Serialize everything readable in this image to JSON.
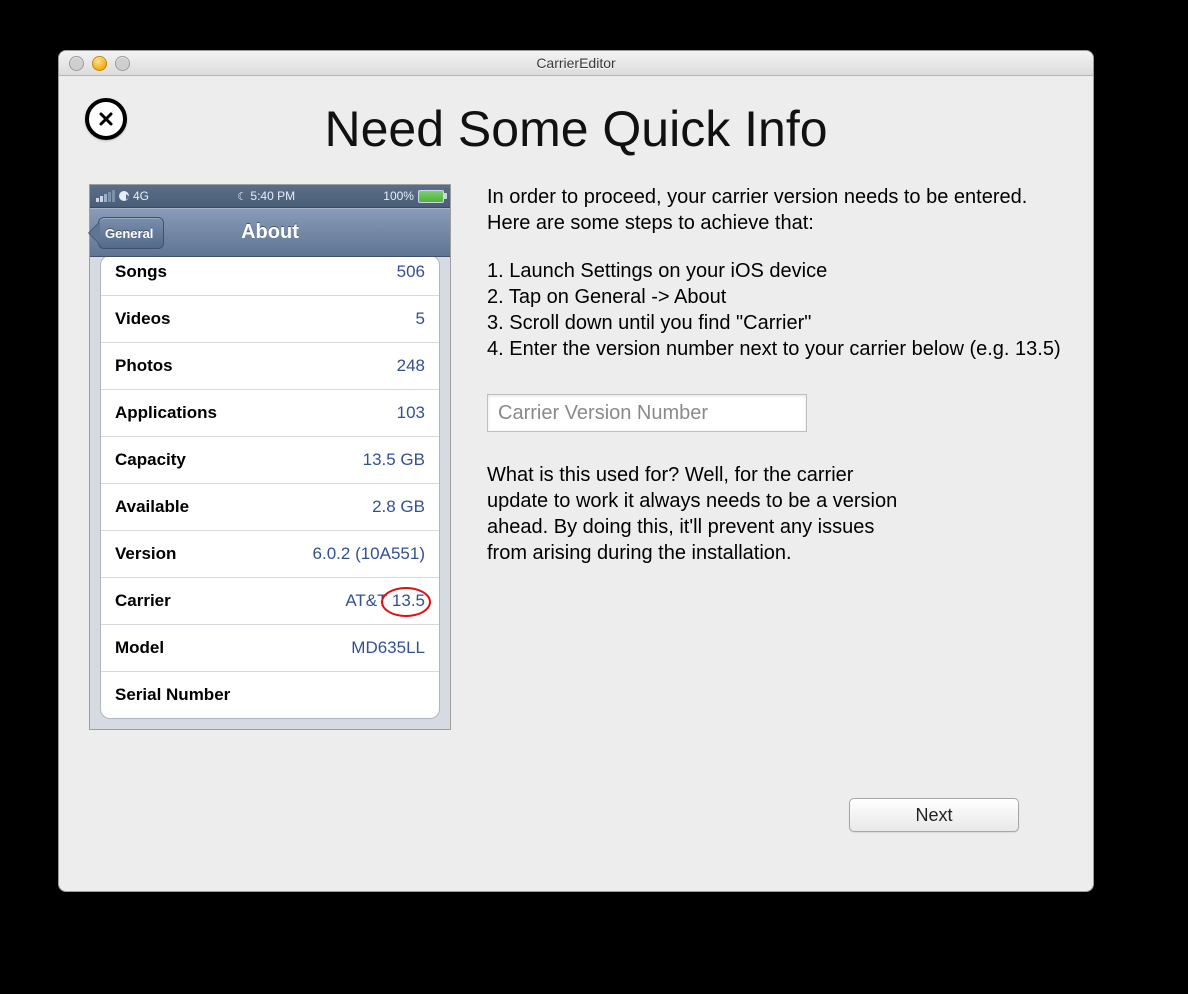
{
  "window": {
    "title": "CarrierEditor"
  },
  "headline": "Need Some Quick Info",
  "phone": {
    "status": {
      "network": "4G",
      "time": "5:40 PM",
      "battery_pct": "100%"
    },
    "nav": {
      "back": "General",
      "title": "About"
    },
    "rows": [
      {
        "k": "Songs",
        "v": "506"
      },
      {
        "k": "Videos",
        "v": "5"
      },
      {
        "k": "Photos",
        "v": "248"
      },
      {
        "k": "Applications",
        "v": "103"
      },
      {
        "k": "Capacity",
        "v": "13.5 GB"
      },
      {
        "k": "Available",
        "v": "2.8 GB"
      },
      {
        "k": "Version",
        "v": "6.0.2 (10A551)"
      },
      {
        "k": "Carrier",
        "v": "AT&T 13.5",
        "circled": true
      },
      {
        "k": "Model",
        "v": "MD635LL"
      },
      {
        "k": "Serial Number",
        "v": ""
      }
    ]
  },
  "instructions": {
    "intro": "In order to proceed, your carrier version needs to be entered. Here are some steps to achieve that:",
    "steps": [
      "1. Launch Settings on your iOS device",
      "2. Tap on General -> About",
      "3. Scroll down until you find \"Carrier\"",
      "4. Enter the version number next to your carrier below (e.g. 13.5)"
    ],
    "placeholder": "Carrier Version Number",
    "explain": "What is this used for? Well, for the carrier update to work it always needs to be a version ahead. By doing this, it'll prevent any issues from arising during the installation."
  },
  "buttons": {
    "next": "Next"
  }
}
